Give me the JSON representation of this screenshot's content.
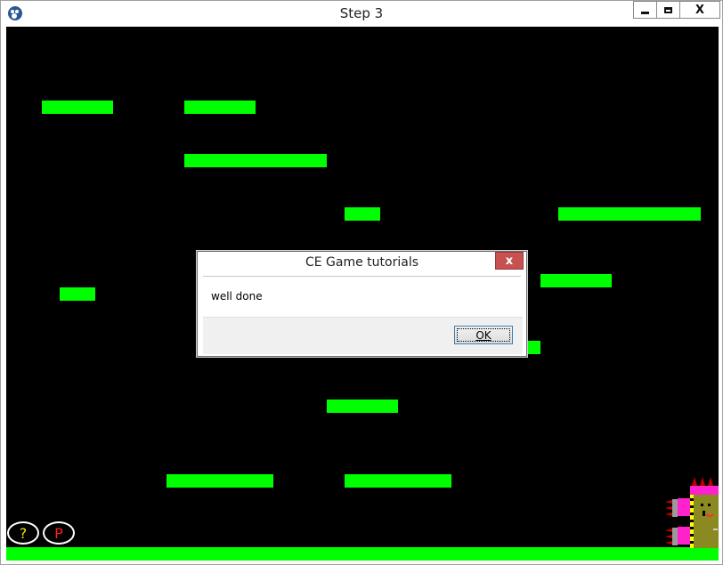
{
  "window": {
    "title": "Step 3",
    "minimize_icon": "minimize-icon",
    "maximize_icon": "maximize-icon",
    "close_label": "X"
  },
  "game": {
    "background": "#000000",
    "platform_color": "#00ff00",
    "help_button_label": "?",
    "help_color": "#f2e200",
    "pause_button_label": "P",
    "pause_color": "#ff0000"
  },
  "dialog": {
    "title": "CE Game tutorials",
    "close_label": "x",
    "message": "well done",
    "ok_label": "OK"
  }
}
